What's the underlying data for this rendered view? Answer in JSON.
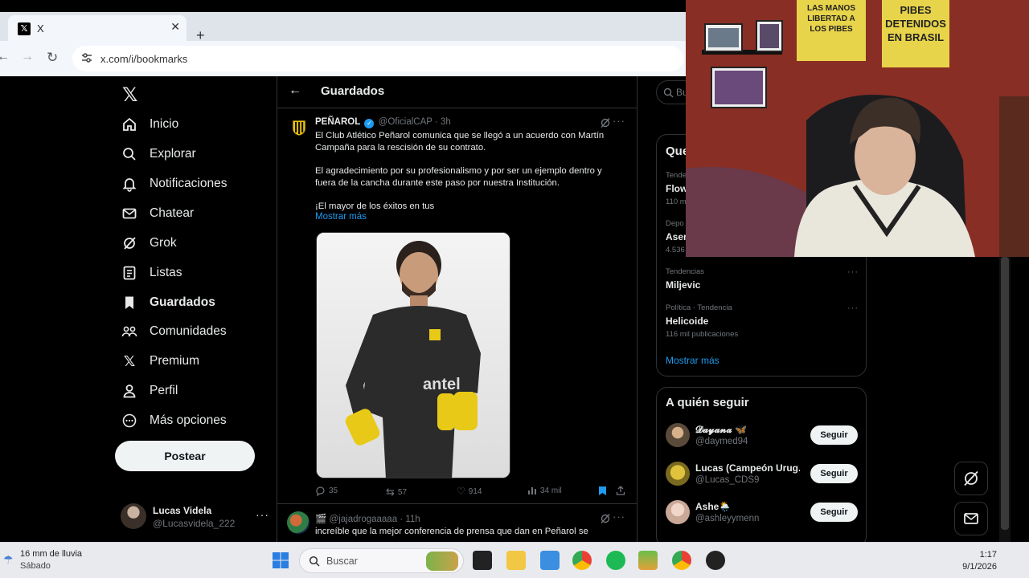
{
  "browser": {
    "tab_title": "X",
    "tab_favicon": "x-logo-icon",
    "url": "x.com/i/bookmarks"
  },
  "sidebar": {
    "items": [
      {
        "label": "Inicio",
        "icon": "home-icon"
      },
      {
        "label": "Explorar",
        "icon": "search-icon"
      },
      {
        "label": "Notificaciones",
        "icon": "bell-icon"
      },
      {
        "label": "Chatear",
        "icon": "mail-icon"
      },
      {
        "label": "Grok",
        "icon": "grok-icon"
      },
      {
        "label": "Listas",
        "icon": "list-icon"
      },
      {
        "label": "Guardados",
        "icon": "bookmark-icon",
        "active": true
      },
      {
        "label": "Comunidades",
        "icon": "people-icon"
      },
      {
        "label": "Premium",
        "icon": "x-logo-icon"
      },
      {
        "label": "Perfil",
        "icon": "person-icon"
      },
      {
        "label": "Más opciones",
        "icon": "more-circle-icon"
      }
    ],
    "post_label": "Postear",
    "account": {
      "name": "Lucas Videla",
      "handle": "@Lucasvidela_222"
    }
  },
  "main": {
    "title": "Guardados",
    "tweets": [
      {
        "name": "PEÑAROL",
        "handle": "@OficialCAP",
        "time": "· 3h",
        "paragraphs": [
          "El Club Atlético Peñarol comunica que se llegó a un acuerdo con Martín Campaña para la rescisión de su contrato.",
          "El agradecimiento por su profesionalismo y por ser un ejemplo dentro y fuera de la cancha durante este paso por nuestra Institución.",
          "¡El mayor de los éxitos en tus"
        ],
        "show_more": "Mostrar más",
        "stats": {
          "replies": "35",
          "reposts": "57",
          "likes": "914",
          "views": "34 mil"
        }
      },
      {
        "name": "🎬",
        "handle": "@jajadrogaaaaa",
        "time": "· 11h",
        "text": "increíble que la mejor conferencia de prensa que dan en Peñarol se"
      }
    ]
  },
  "right": {
    "search_placeholder": "Bu",
    "trends_title": "Que",
    "trends": [
      {
        "category": "Tende",
        "name": "Flow",
        "count": "110 m"
      },
      {
        "category": "Depo",
        "name": "Aser",
        "count": "4.536"
      },
      {
        "category": "Tendencias",
        "name": "Miljevic",
        "count": ""
      },
      {
        "category": "Política · Tendencia",
        "name": "Helicoide",
        "count": "116 mil publicaciones"
      }
    ],
    "trends_more": "Mostrar más",
    "follow_title": "A quién seguir",
    "follow": [
      {
        "name": "𝓓𝓪𝔂𝓪𝓷𝓪 🦋",
        "handle": "@daymed94",
        "button": "Seguir"
      },
      {
        "name": "Lucas (Campeón Urug...",
        "handle": "@Lucas_CDS9",
        "button": "Seguir"
      },
      {
        "name": "Ashe🌦️",
        "handle": "@ashleyymenn",
        "button": "Seguir"
      }
    ]
  },
  "webcam": {
    "poster_left": "LAS MANOS LIBERTAD A LOS PIBES",
    "poster_right": "PIBES DETENIDOS EN BRASIL"
  },
  "taskbar": {
    "weather_line1": "16 mm de lluvia",
    "weather_line2": "Sábado",
    "search_label": "Buscar",
    "time": "1:17",
    "date": "9/1/2026"
  },
  "colors": {
    "accent": "#1d9bf0",
    "bg": "#000000",
    "border": "#2f3336",
    "muted": "#71767b"
  }
}
